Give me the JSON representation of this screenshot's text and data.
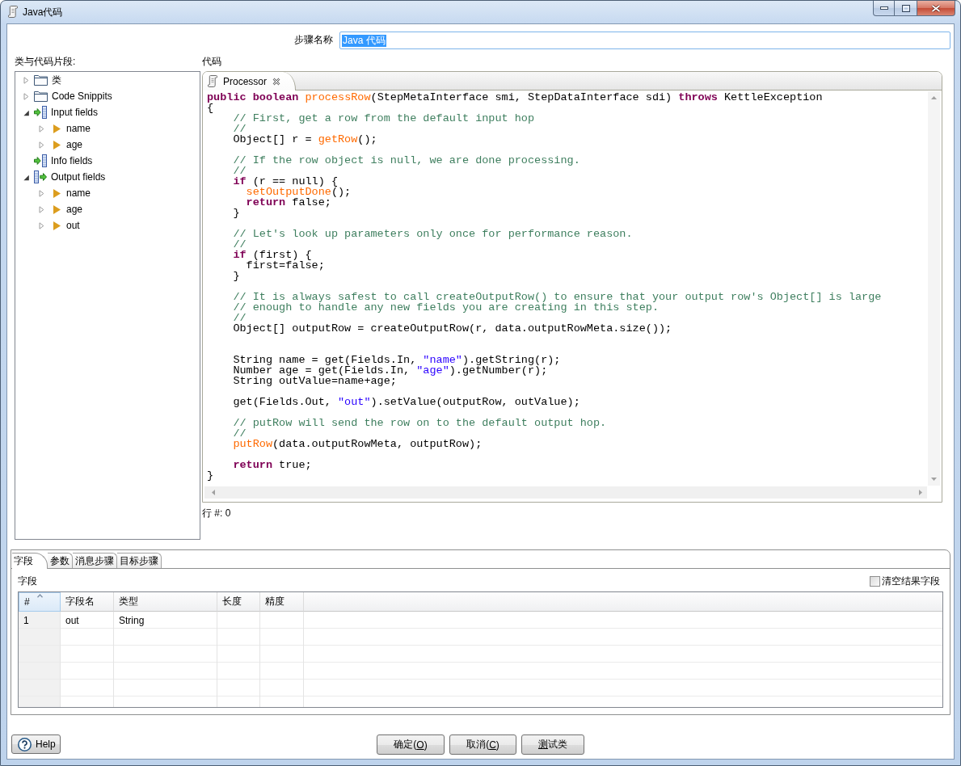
{
  "window": {
    "title": "Java代码"
  },
  "step_name": {
    "label": "步骤名称",
    "value": "Java 代码",
    "value_selected": true
  },
  "snippets": {
    "label": "类与代码片段:",
    "items": [
      {
        "label": "类",
        "kind": "folder",
        "expanded": false
      },
      {
        "label": "Code Snippits",
        "kind": "folder",
        "expanded": false
      },
      {
        "label": "Input fields",
        "kind": "input",
        "expanded": true,
        "children": [
          {
            "label": "name",
            "kind": "field",
            "expanded": false
          },
          {
            "label": "age",
            "kind": "field",
            "expanded": false
          }
        ]
      },
      {
        "label": "Info fields",
        "kind": "input"
      },
      {
        "label": "Output fields",
        "kind": "output",
        "expanded": true,
        "children": [
          {
            "label": "name",
            "kind": "field",
            "expanded": false
          },
          {
            "label": "age",
            "kind": "field",
            "expanded": false
          },
          {
            "label": "out",
            "kind": "field",
            "expanded": false
          }
        ]
      }
    ]
  },
  "editor": {
    "label": "代码",
    "tabs": [
      {
        "label": "Processor",
        "selected": true
      }
    ],
    "lines": [
      {
        "kind": "code",
        "tokens": [
          {
            "kind": "keyword",
            "text": "public"
          },
          {
            "kind": "keyword",
            "text": " boolean"
          },
          {
            "kind": "method",
            "text": " processRow"
          },
          {
            "kind": "plain",
            "text": "(StepMetaInterface smi, StepDataInterface sdi) "
          },
          {
            "kind": "keyword",
            "text": "throws"
          },
          {
            "kind": "plain",
            "text": " KettleException"
          }
        ]
      },
      {
        "kind": "code",
        "tokens": [
          {
            "kind": "plain",
            "text": "{"
          }
        ]
      },
      {
        "kind": "code",
        "tokens": [
          {
            "kind": "comment",
            "text": "    // First, get a row from the default input hop"
          }
        ]
      },
      {
        "kind": "code",
        "tokens": [
          {
            "kind": "comment",
            "text": "    //"
          }
        ]
      },
      {
        "kind": "code",
        "tokens": [
          {
            "kind": "plain",
            "text": "    Object[] r = "
          },
          {
            "kind": "method",
            "text": "getRow"
          },
          {
            "kind": "plain",
            "text": "();"
          }
        ]
      },
      {
        "kind": "blank"
      },
      {
        "kind": "code",
        "tokens": [
          {
            "kind": "comment",
            "text": "    // If the row object is null, we are done processing."
          }
        ]
      },
      {
        "kind": "code",
        "tokens": [
          {
            "kind": "comment",
            "text": "    //"
          }
        ]
      },
      {
        "kind": "code",
        "tokens": [
          {
            "kind": "keyword",
            "text": "    if"
          },
          {
            "kind": "plain",
            "text": " (r == null) {"
          }
        ]
      },
      {
        "kind": "code",
        "tokens": [
          {
            "kind": "method",
            "text": "      setOutputDone"
          },
          {
            "kind": "plain",
            "text": "();"
          }
        ]
      },
      {
        "kind": "code",
        "tokens": [
          {
            "kind": "keyword",
            "text": "      return"
          },
          {
            "kind": "plain",
            "text": " false;"
          }
        ]
      },
      {
        "kind": "code",
        "tokens": [
          {
            "kind": "plain",
            "text": "    }"
          }
        ]
      },
      {
        "kind": "blank"
      },
      {
        "kind": "code",
        "tokens": [
          {
            "kind": "comment",
            "text": "    // Let's look up parameters only once for performance reason."
          }
        ]
      },
      {
        "kind": "code",
        "tokens": [
          {
            "kind": "comment",
            "text": "    //"
          }
        ]
      },
      {
        "kind": "code",
        "tokens": [
          {
            "kind": "keyword",
            "text": "    if"
          },
          {
            "kind": "plain",
            "text": " (first) {"
          }
        ]
      },
      {
        "kind": "code",
        "tokens": [
          {
            "kind": "plain",
            "text": "      first=false;"
          }
        ]
      },
      {
        "kind": "code",
        "tokens": [
          {
            "kind": "plain",
            "text": "    }"
          }
        ]
      },
      {
        "kind": "blank"
      },
      {
        "kind": "code",
        "tokens": [
          {
            "kind": "comment",
            "text": "    // It is always safest to call createOutputRow() to ensure that your output row's Object[] is large"
          }
        ]
      },
      {
        "kind": "code",
        "tokens": [
          {
            "kind": "comment",
            "text": "    // enough to handle any new fields you are creating in this step."
          }
        ]
      },
      {
        "kind": "code",
        "tokens": [
          {
            "kind": "comment",
            "text": "    //"
          }
        ]
      },
      {
        "kind": "code",
        "tokens": [
          {
            "kind": "plain",
            "text": "    Object[] outputRow = createOutputRow(r, data.outputRowMeta.size());"
          }
        ]
      },
      {
        "kind": "blank"
      },
      {
        "kind": "blank"
      },
      {
        "kind": "code",
        "tokens": [
          {
            "kind": "plain",
            "text": "    String name = get(Fields.In, "
          },
          {
            "kind": "string",
            "text": "\"name\""
          },
          {
            "kind": "plain",
            "text": ").getString(r);"
          }
        ]
      },
      {
        "kind": "code",
        "tokens": [
          {
            "kind": "plain",
            "text": "    Number age = get(Fields.In, "
          },
          {
            "kind": "string",
            "text": "\"age\""
          },
          {
            "kind": "plain",
            "text": ").getNumber(r);"
          }
        ]
      },
      {
        "kind": "code",
        "tokens": [
          {
            "kind": "plain",
            "text": "    String outValue=name+age;"
          }
        ]
      },
      {
        "kind": "blank"
      },
      {
        "kind": "code",
        "tokens": [
          {
            "kind": "plain",
            "text": "    get(Fields.Out, "
          },
          {
            "kind": "string",
            "text": "\"out\""
          },
          {
            "kind": "plain",
            "text": ").setValue(outputRow, outValue);"
          }
        ]
      },
      {
        "kind": "blank"
      },
      {
        "kind": "code",
        "tokens": [
          {
            "kind": "comment",
            "text": "    // putRow will send the row on to the default output hop."
          }
        ]
      },
      {
        "kind": "code",
        "tokens": [
          {
            "kind": "comment",
            "text": "    //"
          }
        ]
      },
      {
        "kind": "code",
        "tokens": [
          {
            "kind": "method",
            "text": "    putRow"
          },
          {
            "kind": "plain",
            "text": "(data.outputRowMeta, outputRow);"
          }
        ]
      },
      {
        "kind": "blank"
      },
      {
        "kind": "code",
        "tokens": [
          {
            "kind": "keyword",
            "text": "    return"
          },
          {
            "kind": "plain",
            "text": " true;"
          }
        ]
      },
      {
        "kind": "code",
        "tokens": [
          {
            "kind": "plain",
            "text": "}"
          }
        ]
      }
    ],
    "status": "行 #: 0"
  },
  "fields_panel": {
    "tabs": [
      {
        "label": "字段",
        "selected": true
      },
      {
        "label": "参数",
        "selected": false
      },
      {
        "label": "消息步骤",
        "selected": false
      },
      {
        "label": "目标步骤",
        "selected": false
      }
    ],
    "label": "字段",
    "clear_result_fields": {
      "label": "清空结果字段",
      "checked": false
    },
    "table": {
      "columns": [
        {
          "label": "#",
          "sorted": true
        },
        {
          "label": "字段名",
          "sorted": false
        },
        {
          "label": "类型",
          "sorted": false
        },
        {
          "label": "长度",
          "sorted": false
        },
        {
          "label": "精度",
          "sorted": false
        }
      ],
      "rows": [
        {
          "cells": [
            "1",
            "out",
            "String"
          ]
        }
      ]
    }
  },
  "buttons": {
    "help": {
      "label": "Help"
    },
    "actions": [
      {
        "before": "确定(",
        "mnemonic": "O",
        "after": ")"
      },
      {
        "before": "取消(",
        "mnemonic": "C",
        "after": ")"
      },
      {
        "mnemonic": "测",
        "after": "试类"
      }
    ]
  }
}
